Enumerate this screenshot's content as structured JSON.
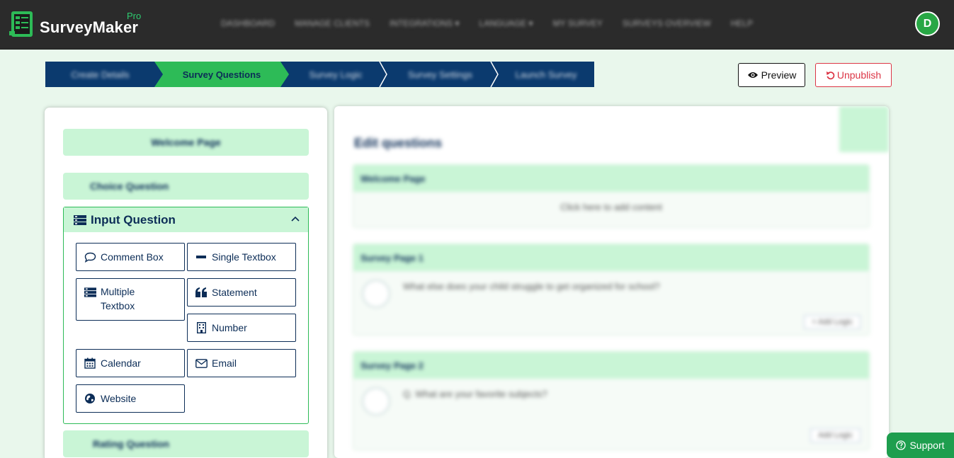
{
  "app": {
    "name": "SurveyMaker",
    "badge": "Pro"
  },
  "nav": {
    "items": [
      "DASHBOARD",
      "MANAGE CLIENTS",
      "INTEGRATIONS ▾",
      "LANGUAGE ▾",
      "MY SURVEY",
      "SURVEYS OVERVIEW",
      "HELP"
    ]
  },
  "user": {
    "initial": "D"
  },
  "steps": {
    "items": [
      "Create Details",
      "Survey Questions",
      "Survey Logic",
      "Survey Settings",
      "Launch Survey"
    ],
    "active_index": 1
  },
  "actions": {
    "preview_label": "Preview",
    "unpublish_label": "Unpublish"
  },
  "sidebar": {
    "welcome_page": "Welcome Page",
    "choice_question": "Choice Question",
    "input_question": {
      "title": "Input Question",
      "buttons": {
        "comment_box": "Comment Box",
        "single_textbox": "Single Textbox",
        "multiple_textbox": "Multiple Textbox",
        "statement": "Statement",
        "number": "Number",
        "calendar": "Calendar",
        "email": "Email",
        "website": "Website"
      }
    },
    "rating_question": "Rating Question"
  },
  "canvas": {
    "title": "Edit questions",
    "welcome_header": "Welcome Page",
    "welcome_note": "Click here to add content",
    "page1_header": "Survey Page 1",
    "q1": "What else does your child struggle to get organized for school?",
    "add_logic_1": "+ Add Logic",
    "page2_header": "Survey Page 2",
    "q2": "Q. What are your favorite subjects?",
    "add_logic_2": "Add Logic"
  },
  "support": {
    "label": "Support"
  },
  "colors": {
    "navy": "#0c2d57",
    "green": "#2dbb57",
    "mint": "#c9f5d6",
    "danger": "#dc3545"
  }
}
